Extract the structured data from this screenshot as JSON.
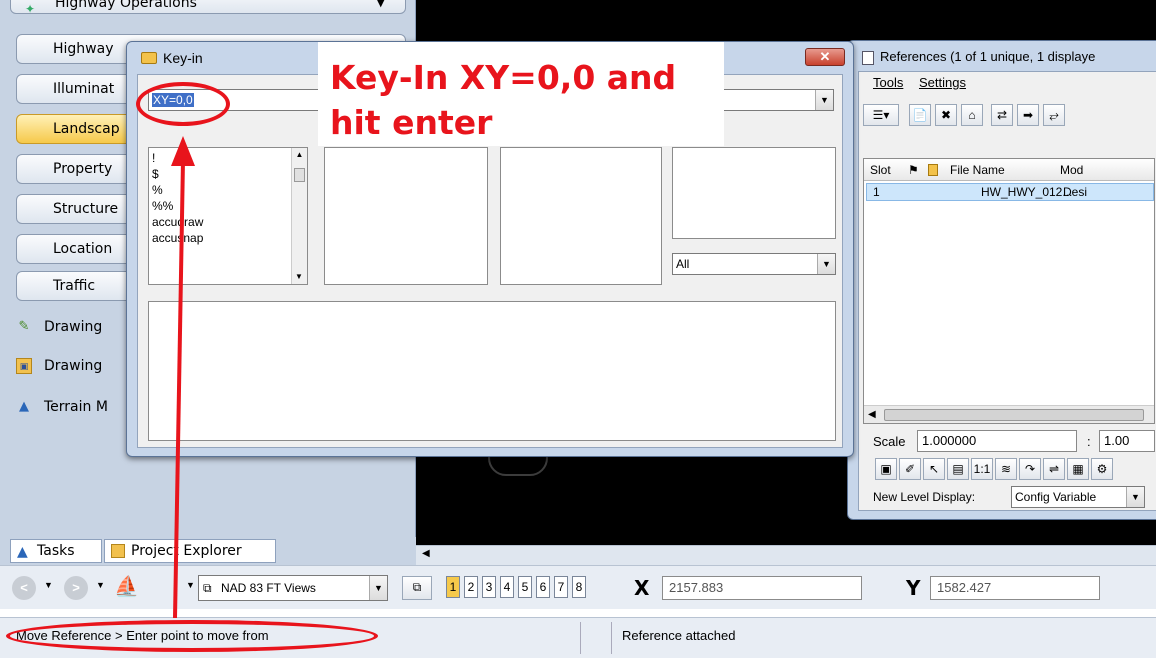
{
  "left_panel": {
    "header": "Highway Operations",
    "task_buttons": [
      {
        "label": "Highway"
      },
      {
        "label": "Illuminat"
      },
      {
        "label": "Landscap",
        "active": true
      },
      {
        "label": "Property"
      },
      {
        "label": "Structure"
      },
      {
        "label": "Location"
      },
      {
        "label": "Traffic"
      }
    ],
    "drawing_items": [
      {
        "label": "Drawing",
        "icon": "pencil-icon"
      },
      {
        "label": "Drawing",
        "icon": "folder-icon"
      },
      {
        "label": "Terrain M",
        "icon": "terrain-icon"
      }
    ],
    "tabs": [
      "Tasks",
      "Project Explorer"
    ]
  },
  "keyin": {
    "title": "Key-in",
    "input_value": "XY=0,0",
    "commands": [
      "!",
      "$",
      "%",
      "%%",
      "accudraw",
      "accusnap"
    ],
    "filter_value": "All"
  },
  "annotation": {
    "text_line1": "Key-In XY=0,0 and",
    "text_line2": "hit enter",
    "color": "#e8141c"
  },
  "references": {
    "title": "References (1 of 1 unique, 1 displaye",
    "menu": [
      "Tools",
      "Settings"
    ],
    "columns": [
      "Slot",
      "File Name",
      "Mod"
    ],
    "rows": [
      {
        "slot": "1",
        "file_name": "HW_HWY_012...",
        "model": "Desi"
      }
    ],
    "scale_label": "Scale",
    "scale_value": "1.000000",
    "scale_sep": ":",
    "scale_value2": "1.00",
    "level_display_label": "New Level Display:",
    "level_display_value": "Config Variable"
  },
  "view_bar": {
    "view_group": "NAD 83 FT Views",
    "view_numbers": [
      "1",
      "2",
      "3",
      "4",
      "5",
      "6",
      "7",
      "8"
    ],
    "x_label": "X",
    "x_value": "2157.883",
    "y_label": "Y",
    "y_value": "1582.427"
  },
  "status_bar": {
    "prompt": "Move Reference > Enter point to move from",
    "message": "Reference attached"
  }
}
